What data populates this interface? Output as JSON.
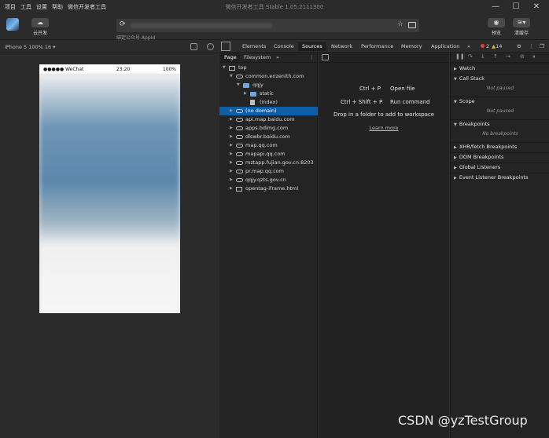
{
  "titlebar": {
    "menu": [
      "项目",
      "工具",
      "设置",
      "帮助",
      "微信开发者工具"
    ],
    "title": "微信开发者工具 Stable 1.05.2111300",
    "controls": {
      "minimize": "—",
      "maximize": "☐",
      "close": "✕"
    }
  },
  "toolbar": {
    "cloud_label": "云开发",
    "appid_label": "绑定公众号 AppId",
    "preview_label": "预览",
    "clear_cache_label": "清缓存"
  },
  "simulator": {
    "device": "iPhone 5 100% 16 ▾",
    "status": {
      "carrier": "●●●●● WeChat",
      "time": "23:20",
      "battery": "100%"
    }
  },
  "devtools": {
    "tabs": [
      "Elements",
      "Console",
      "Sources",
      "Network",
      "Performance",
      "Memory",
      "Application"
    ],
    "active_tab": "Sources",
    "more": "»",
    "errors": "2",
    "warnings": "14"
  },
  "navigator": {
    "tabs": [
      "Page",
      "Filesystem"
    ],
    "active_tab": "Page",
    "tree": [
      {
        "label": "top",
        "depth": 0,
        "icon": "frame",
        "arrow": "▼"
      },
      {
        "label": "common.enzenith.com",
        "depth": 1,
        "icon": "cloud",
        "arrow": "▼"
      },
      {
        "label": "qqjy",
        "depth": 2,
        "icon": "folder",
        "arrow": "▼"
      },
      {
        "label": "static",
        "depth": 3,
        "icon": "folder",
        "arrow": "▶"
      },
      {
        "label": "(index)",
        "depth": 3,
        "icon": "file",
        "arrow": ""
      },
      {
        "label": "(no domain)",
        "depth": 1,
        "icon": "cloud",
        "arrow": "▶",
        "selected": true
      },
      {
        "label": "api.map.baidu.com",
        "depth": 1,
        "icon": "cloud",
        "arrow": "▶"
      },
      {
        "label": "apps.bdimg.com",
        "depth": 1,
        "icon": "cloud",
        "arrow": "▶"
      },
      {
        "label": "dlswbr.baidu.com",
        "depth": 1,
        "icon": "cloud",
        "arrow": "▶"
      },
      {
        "label": "map.qq.com",
        "depth": 1,
        "icon": "cloud",
        "arrow": "▶"
      },
      {
        "label": "mapapi.qq.com",
        "depth": 1,
        "icon": "cloud",
        "arrow": "▶"
      },
      {
        "label": "mztapp.fujian.gov.cn:8203",
        "depth": 1,
        "icon": "cloud",
        "arrow": "▶"
      },
      {
        "label": "pr.map.qq.com",
        "depth": 1,
        "icon": "cloud",
        "arrow": "▶"
      },
      {
        "label": "qqjy.qzts.gov.cn",
        "depth": 1,
        "icon": "cloud",
        "arrow": "▶"
      },
      {
        "label": "opentag-iframe.html",
        "depth": 1,
        "icon": "frame",
        "arrow": "▶"
      }
    ]
  },
  "editor": {
    "shortcuts": [
      {
        "keys": "Ctrl + P",
        "action": "Open file"
      },
      {
        "keys": "Ctrl + Shift + P",
        "action": "Run command"
      }
    ],
    "drop_hint": "Drop in a folder to add to workspace",
    "learn_more": "Learn more"
  },
  "debugger": {
    "sections": [
      {
        "title": "Watch",
        "open": false
      },
      {
        "title": "Call Stack",
        "open": true,
        "note": "Not paused"
      },
      {
        "title": "Scope",
        "open": true,
        "note": "Not paused"
      },
      {
        "title": "Breakpoints",
        "open": true,
        "note": "No breakpoints"
      },
      {
        "title": "XHR/fetch Breakpoints",
        "open": false
      },
      {
        "title": "DOM Breakpoints",
        "open": false
      },
      {
        "title": "Global Listeners",
        "open": false
      },
      {
        "title": "Event Listener Breakpoints",
        "open": false
      }
    ]
  },
  "watermark": "CSDN @yzTestGroup"
}
